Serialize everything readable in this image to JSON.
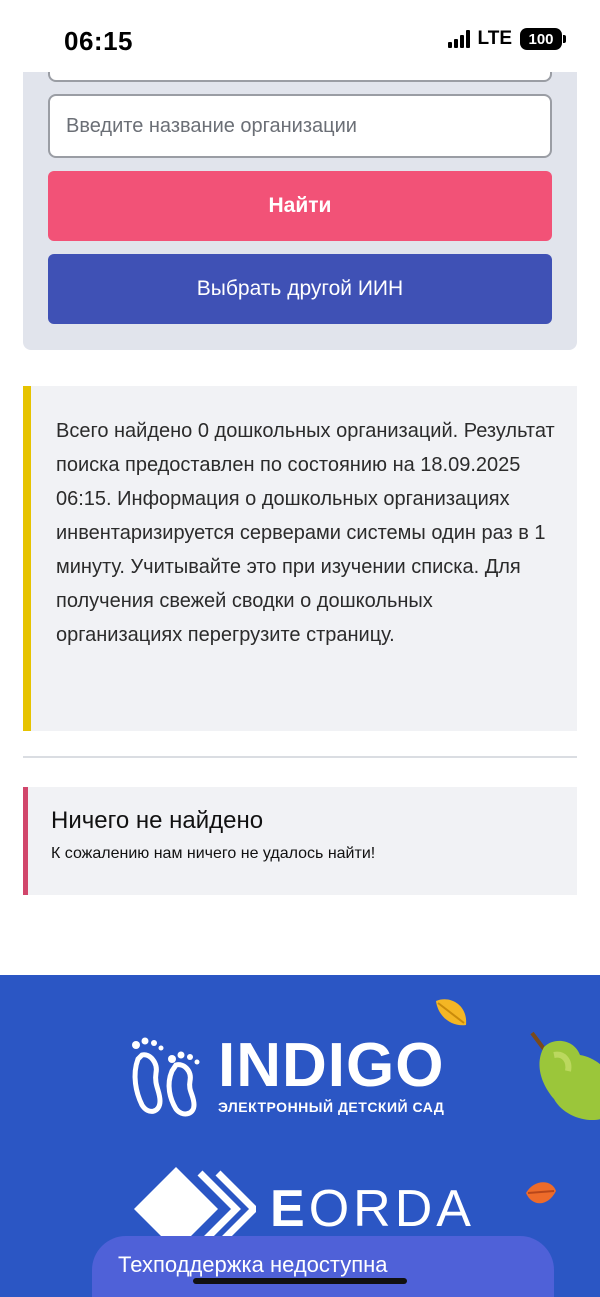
{
  "status_bar": {
    "time": "06:15",
    "network": "LTE",
    "battery": "100"
  },
  "search": {
    "org_placeholder": "Введите название организации",
    "find_label": "Найти",
    "change_iin_label": "Выбрать другой ИИН"
  },
  "info": {
    "text": "Всего найдено 0 дошкольных организаций. Результат поиска предоставлен по состоянию на 18.09.2025 06:15. Информация о дошкольных организациях инвентаризируется серверами системы один раз в 1 минуту. Учитывайте это при изучении списка. Для получения свежей сводки о дошкольных организациях перегрузите страницу."
  },
  "not_found": {
    "title": "Ничего не найдено",
    "text": "К сожалению нам ничего не удалось найти!"
  },
  "footer": {
    "indigo_title": "INDIGO",
    "indigo_subtitle": "ЭЛЕКТРОННЫЙ ДЕТСКИЙ САД",
    "eorda_first": "E",
    "eorda_rest": "ORDA"
  },
  "support": {
    "label": "Техподдержка недоступна"
  },
  "colors": {
    "find_button": "#f25277",
    "iin_button": "#3f51b5",
    "info_accent": "#e6c300",
    "notfound_accent": "#d1466b",
    "footer_bg": "#2b56c4"
  }
}
